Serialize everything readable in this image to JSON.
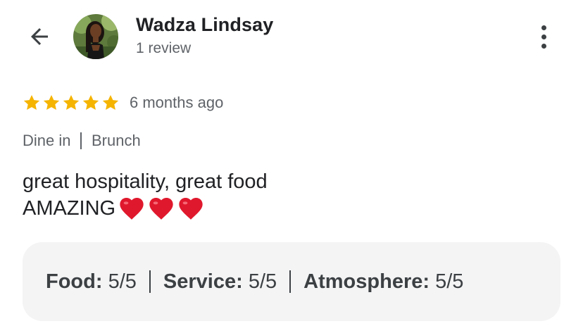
{
  "header": {
    "back_icon": "arrow-left-icon",
    "reviewer_name": "Wadza Lindsay",
    "review_count": "1 review",
    "more_icon": "more-vertical-icon"
  },
  "review": {
    "rating": 5,
    "rating_max": 5,
    "star_color": "#F5B400",
    "time_ago": "6 months ago",
    "meta": [
      "Dine in",
      "Brunch"
    ],
    "text_line1": "great hospitality, great food",
    "text_line2": "AMAZING",
    "emoji": [
      "❤️",
      "❤️",
      "❤️"
    ]
  },
  "ratings": [
    {
      "label": "Food:",
      "value": "5/5"
    },
    {
      "label": "Service:",
      "value": "5/5"
    },
    {
      "label": "Atmosphere:",
      "value": "5/5"
    }
  ]
}
